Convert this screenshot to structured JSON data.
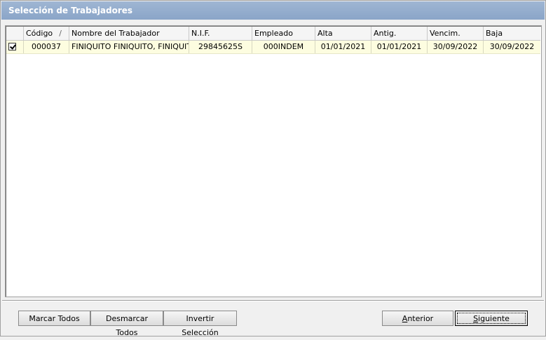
{
  "window": {
    "title": "Selección de Trabajadores"
  },
  "grid": {
    "columns": [
      {
        "key": "check",
        "label": ""
      },
      {
        "key": "codigo",
        "label": "Código",
        "sort": "/"
      },
      {
        "key": "nombre",
        "label": "Nombre del Trabajador"
      },
      {
        "key": "nif",
        "label": "N.I.F."
      },
      {
        "key": "empleado",
        "label": "Empleado"
      },
      {
        "key": "alta",
        "label": "Alta"
      },
      {
        "key": "antig",
        "label": "Antig."
      },
      {
        "key": "vencim",
        "label": "Vencim."
      },
      {
        "key": "baja",
        "label": "Baja"
      }
    ],
    "rows": [
      {
        "checked": true,
        "codigo": "000037",
        "nombre": "FINIQUITO FINIQUITO, FINIQUITO",
        "nif": "29845625S",
        "empleado": "000INDEM",
        "alta": "01/01/2021",
        "antig": "01/01/2021",
        "vencim": "30/09/2022",
        "baja": "30/09/2022"
      }
    ]
  },
  "buttons": {
    "marcar_todos": "Marcar Todos",
    "desmarcar_todos": "Desmarcar Todos",
    "invertir_seleccion": "Invertir Selección",
    "anterior": {
      "accel": "A",
      "rest": "nterior"
    },
    "siguiente": {
      "accel": "S",
      "rest": "iguiente"
    }
  }
}
